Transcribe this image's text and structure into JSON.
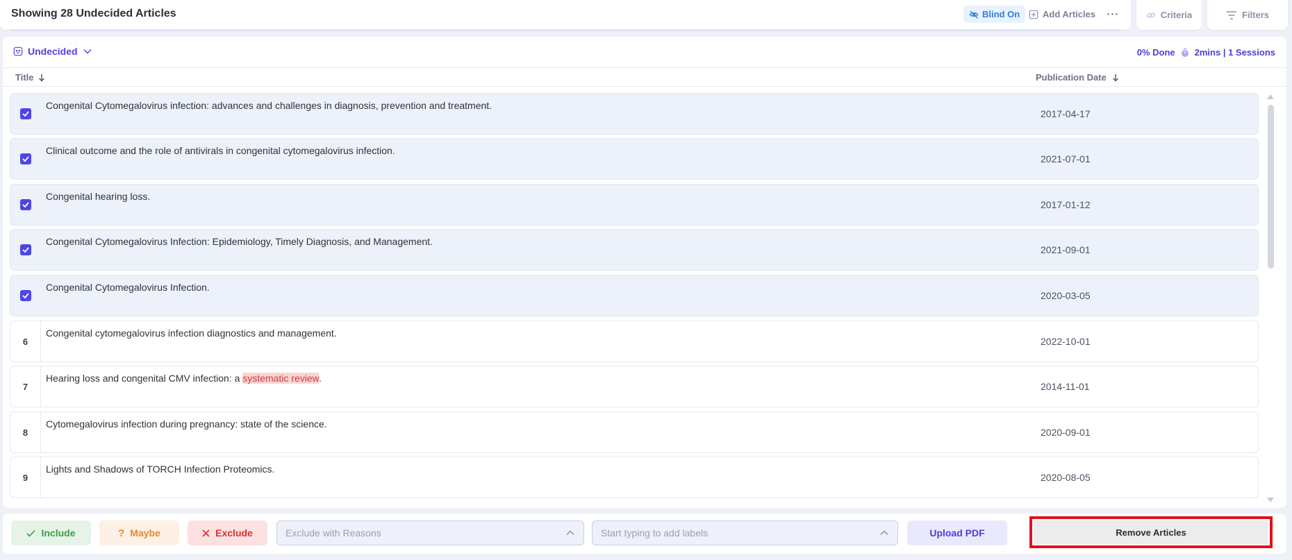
{
  "header": {
    "title": "Showing 28 Undecided Articles",
    "blind_label": "Blind On",
    "add_articles_label": "Add Articles",
    "more_label": "⋯",
    "criteria_label": "Criteria",
    "filters_label": "Filters"
  },
  "status": {
    "filter_label": "Undecided",
    "progress": "0% Done",
    "sessions": "2mins | 1 Sessions"
  },
  "columns": {
    "title": "Title",
    "date": "Publication Date"
  },
  "rows": [
    {
      "num": "",
      "selected": true,
      "title": "Congenital Cytomegalovirus infection: advances and challenges in diagnosis, prevention and treatment.",
      "date": "2017-04-17"
    },
    {
      "num": "",
      "selected": true,
      "title": "Clinical outcome and the role of antivirals in congenital cytomegalovirus infection.",
      "date": "2021-07-01"
    },
    {
      "num": "",
      "selected": true,
      "title": "Congenital hearing loss.",
      "date": "2017-01-12"
    },
    {
      "num": "",
      "selected": true,
      "title": "Congenital Cytomegalovirus Infection: Epidemiology, Timely Diagnosis, and Management.",
      "date": "2021-09-01"
    },
    {
      "num": "",
      "selected": true,
      "title": "Congenital Cytomegalovirus Infection.",
      "date": "2020-03-05"
    },
    {
      "num": "6",
      "selected": false,
      "title": "Congenital cytomegalovirus infection diagnostics and management.",
      "date": "2022-10-01"
    },
    {
      "num": "7",
      "selected": false,
      "title_pre": "Hearing loss and congenital CMV infection: a ",
      "title_hl": "systematic review",
      "title_post": ".",
      "date": "2014-11-01"
    },
    {
      "num": "8",
      "selected": false,
      "title": "Cytomegalovirus infection during pregnancy: state of the science.",
      "date": "2020-09-01"
    },
    {
      "num": "9",
      "selected": false,
      "title": "Lights and Shadows of TORCH Infection Proteomics.",
      "date": "2020-08-05"
    }
  ],
  "actions": {
    "include": "Include",
    "maybe": "Maybe",
    "exclude": "Exclude",
    "reasons_placeholder": "Exclude with Reasons",
    "labels_placeholder": "Start typing to add labels",
    "upload_pdf": "Upload PDF",
    "remove_articles": "Remove Articles"
  },
  "colors": {
    "accent": "#4f46e5",
    "include": "#3d9b47",
    "maybe": "#e58a33",
    "exclude": "#d93030",
    "highlight_box": "#e0121b"
  }
}
